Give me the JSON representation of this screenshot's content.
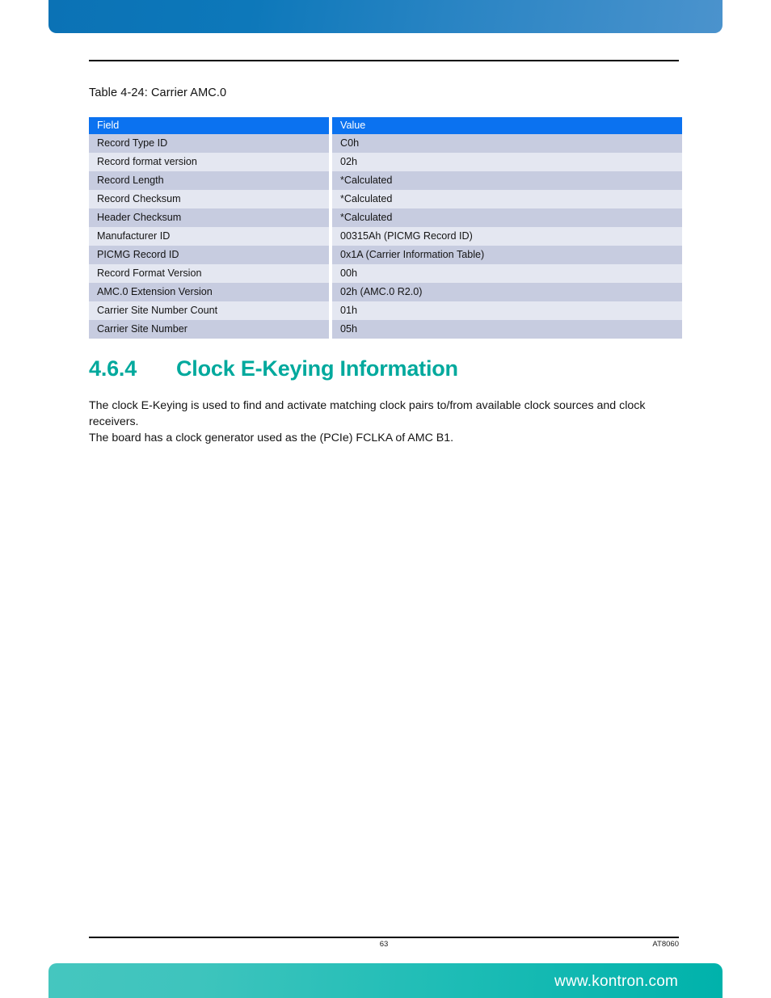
{
  "header_banner": {
    "name": "top-decorative-banner"
  },
  "table_caption": "Table 4-24: Carrier AMC.0",
  "table": {
    "columns": [
      "Field",
      "Value"
    ],
    "rows": [
      {
        "field": "Record Type ID",
        "value": "C0h"
      },
      {
        "field": "Record format version",
        "value": "02h"
      },
      {
        "field": "Record Length",
        "value": "*Calculated"
      },
      {
        "field": "Record Checksum",
        "value": "*Calculated"
      },
      {
        "field": "Header Checksum",
        "value": "*Calculated"
      },
      {
        "field": "Manufacturer ID",
        "value": "00315Ah (PICMG Record ID)"
      },
      {
        "field": "PICMG Record ID",
        "value": "0x1A (Carrier Information Table)"
      },
      {
        "field": "Record Format Version",
        "value": "00h"
      },
      {
        "field": "AMC.0 Extension Version",
        "value": "02h (AMC.0 R2.0)"
      },
      {
        "field": "Carrier Site Number Count",
        "value": "01h"
      },
      {
        "field": "Carrier Site Number",
        "value": "05h"
      }
    ]
  },
  "section": {
    "number": "4.6.4",
    "title": "Clock E-Keying Information"
  },
  "body": {
    "paragraph": "The clock E-Keying is used to find and activate matching clock pairs to/from available clock sources and clock receivers.",
    "paragraph2": "The board  has a clock generator used as the (PCIe) FCLKA of AMC B1."
  },
  "footer": {
    "page_number": "63",
    "document_id": "AT8060",
    "website": "www.kontron.com"
  },
  "colors": {
    "table_header_blue": "#0b72f0",
    "row_dark": "#c7cce0",
    "row_light": "#e4e7f1",
    "heading_teal": "#00a99d",
    "banner_blue_left": "#0b72b5",
    "banner_blue_right": "#4b93cd",
    "banner_teal_left": "#45c6bf",
    "banner_teal_right": "#00b2ab"
  }
}
